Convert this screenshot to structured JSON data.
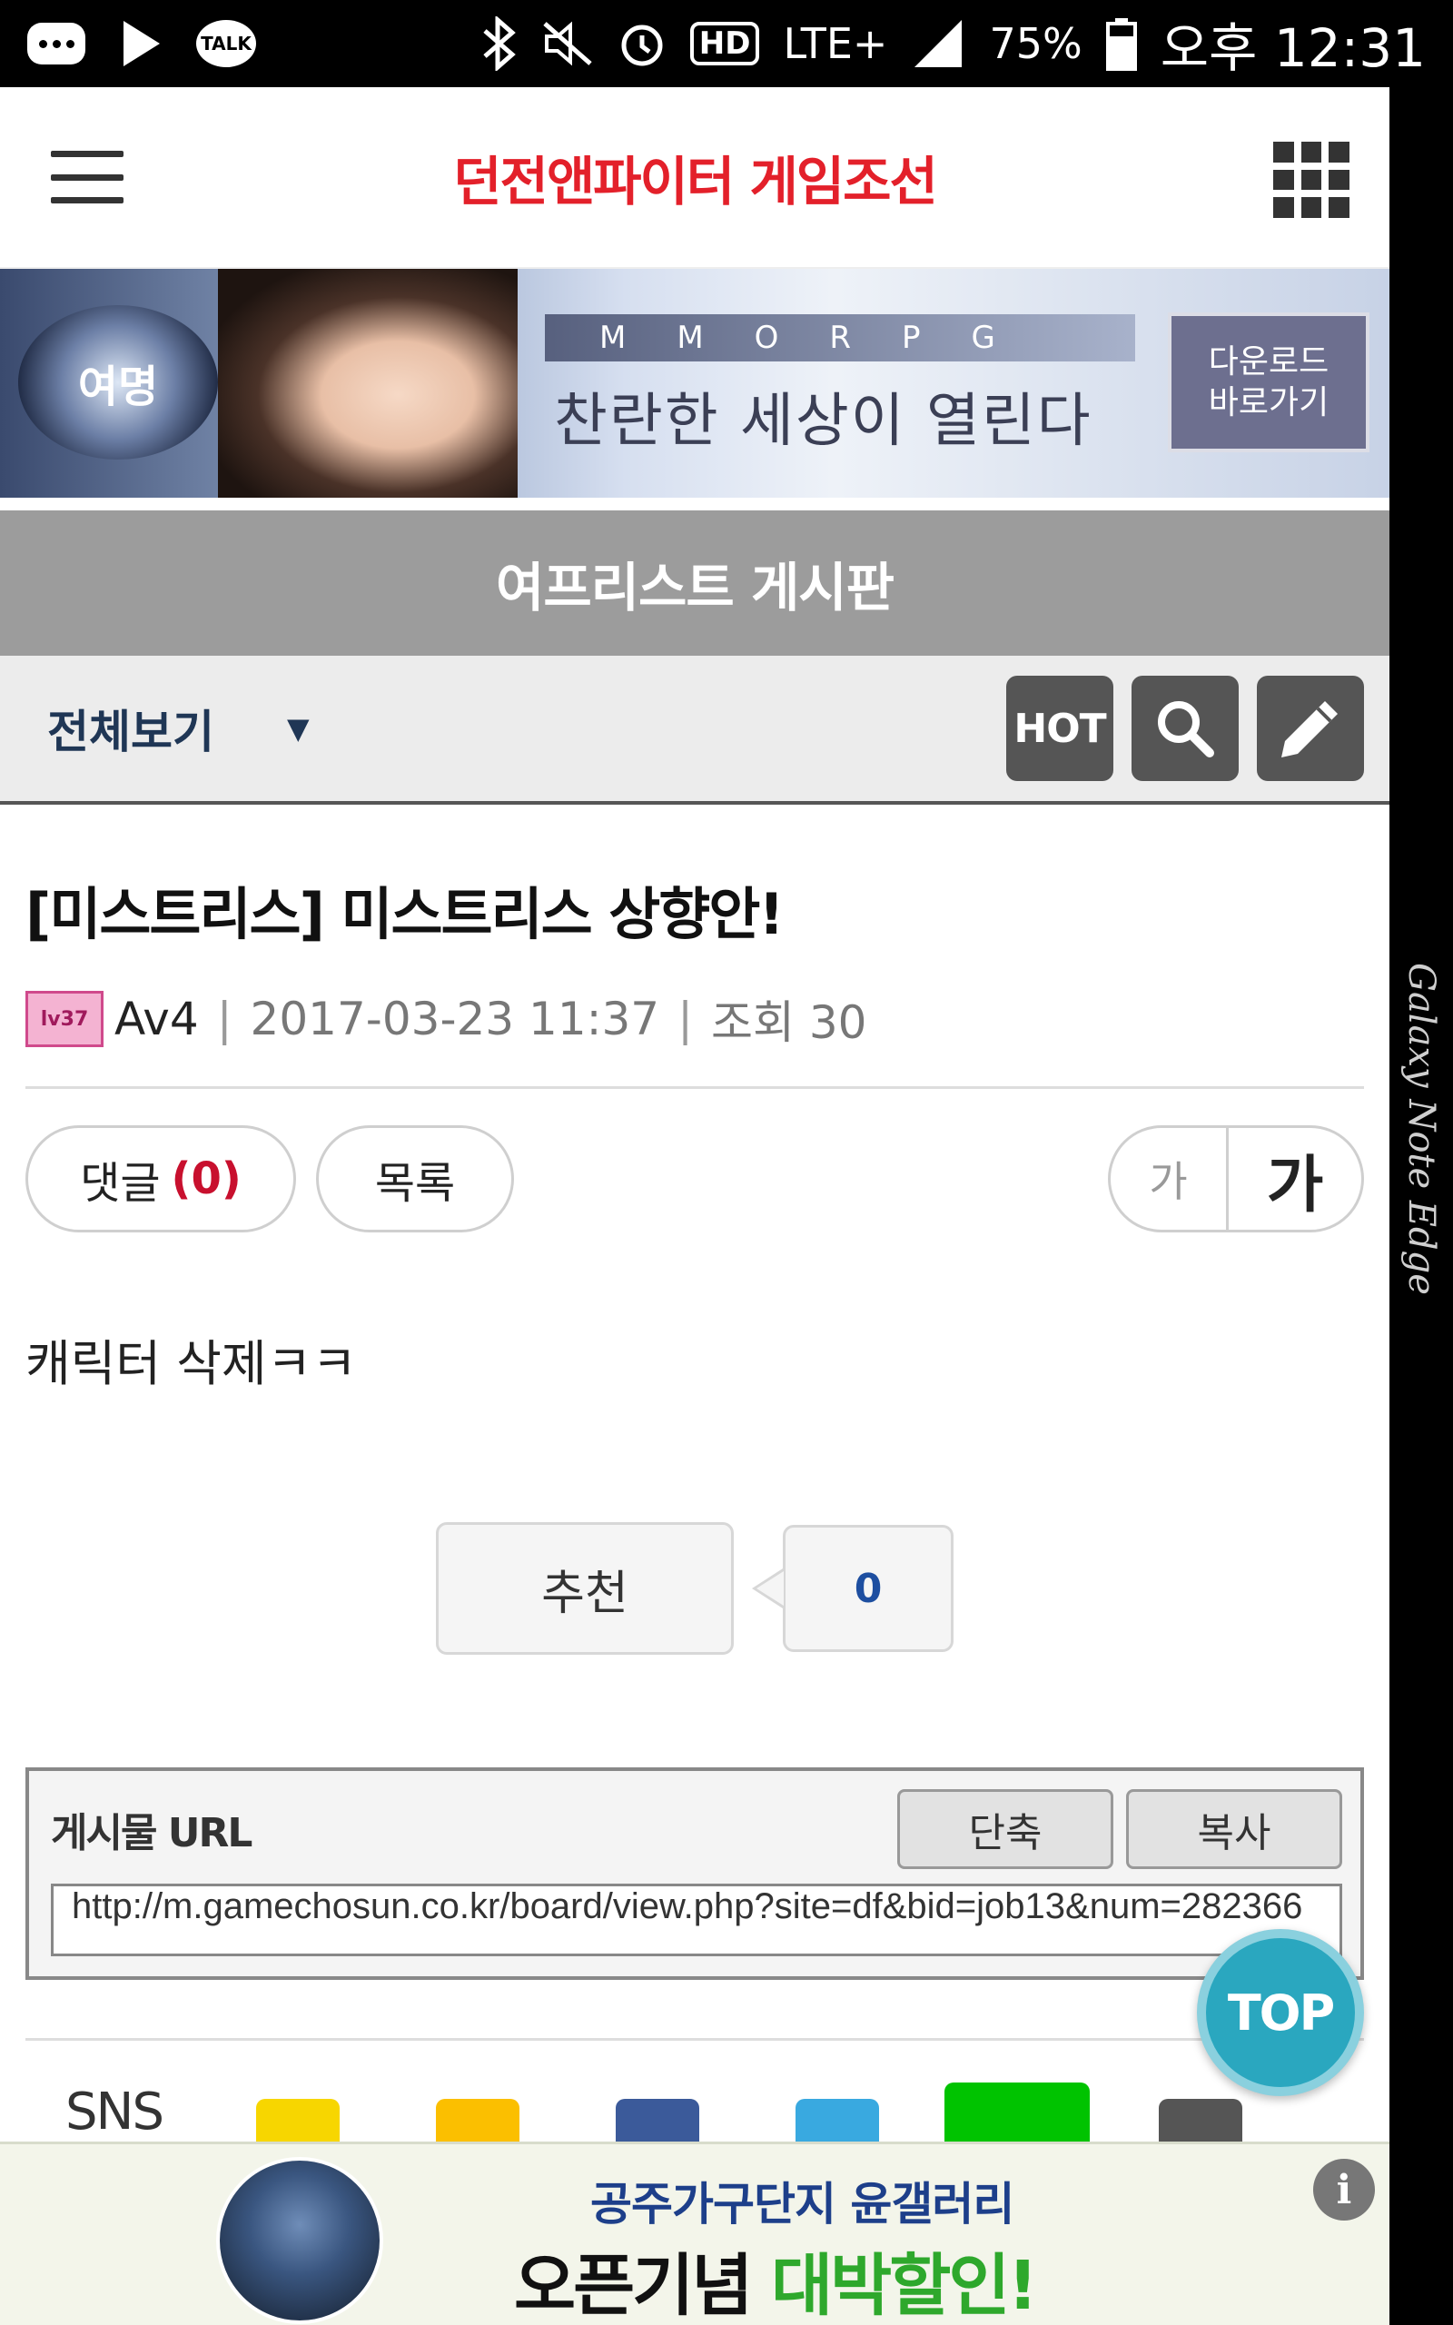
{
  "status_bar": {
    "talk_badge": "TALK",
    "hd": "HD",
    "network": "LTE+",
    "battery": "75%",
    "time": "오후 12:31"
  },
  "device": {
    "edge_label": "Galaxy Note Edge"
  },
  "header": {
    "title": "던전앤파이터 게임조선"
  },
  "banner": {
    "logo_text": "여명",
    "tag": "MMORPG",
    "copy": "찬란한 세상이 열린다",
    "button_line1": "다운로드",
    "button_line2": "바로가기"
  },
  "board": {
    "title": "여프리스트 게시판"
  },
  "filter": {
    "selected": "전체보기",
    "hot_label": "HOT"
  },
  "post": {
    "title": "[미스트리스] 미스트리스 상향안!",
    "level_badge": "lv37",
    "author": "Av4",
    "separator": "|",
    "datetime": "2017-03-23 11:37",
    "views": "조회 30",
    "comment_label": "댓글",
    "comment_count": "(0)",
    "list_label": "목록",
    "font_small": "가",
    "font_large": "가",
    "body": "캐릭터 삭제ㅋㅋ",
    "recommend_label": "추천",
    "recommend_count": "0"
  },
  "url_box": {
    "label": "게시물 URL",
    "shorten_label": "단축",
    "copy_label": "복사",
    "url": "http://m.gamechosun.co.kr/board/view.php?site=df&bid=job13&num=282366"
  },
  "sns": {
    "label": "SNS"
  },
  "top_button": "TOP",
  "bottom_ad": {
    "line1": "공주가구단지 윤갤러리",
    "line2_prefix": "오픈기념",
    "line2_highlight": "대박할인!",
    "info": "i"
  },
  "colors": {
    "title_red": "#e3202a",
    "board_bar": "#9c9c9c",
    "filter_text": "#1f3655",
    "comment_count": "#c8102e",
    "recommend_count": "#1d4ea0",
    "top_button": "#2aa7bf",
    "ad_green": "#2ea82c"
  },
  "icons": {
    "menu": "hamburger-icon",
    "apps": "grid-icon",
    "search": "search-icon",
    "write": "pencil-icon",
    "caret": "caret-down-icon"
  }
}
